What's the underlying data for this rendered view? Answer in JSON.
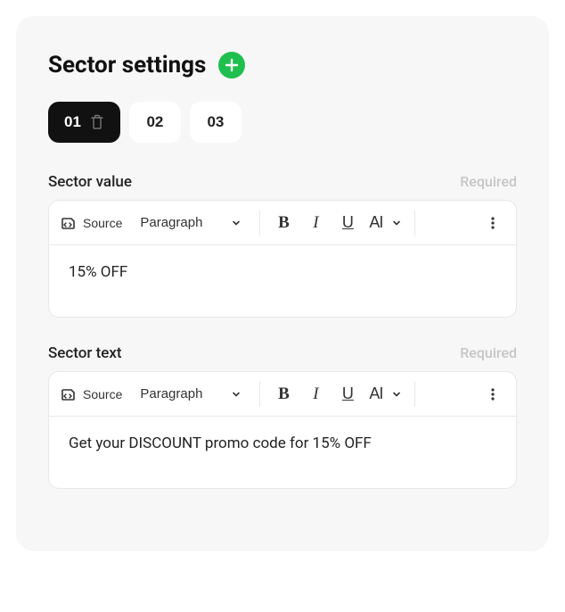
{
  "header": {
    "title": "Sector settings"
  },
  "tabs": [
    {
      "label": "01",
      "active": true,
      "deletable": true
    },
    {
      "label": "02",
      "active": false
    },
    {
      "label": "03",
      "active": false
    }
  ],
  "toolbar": {
    "source": "Source",
    "paragraph": "Paragraph",
    "bold": "B",
    "italic": "I",
    "underline": "U",
    "font": "AI"
  },
  "fields": {
    "sectorValue": {
      "label": "Sector value",
      "required": "Required",
      "content": "15% OFF"
    },
    "sectorText": {
      "label": "Sector text",
      "required": "Required",
      "content": "Get your DISCOUNT promo code for 15% OFF"
    }
  }
}
